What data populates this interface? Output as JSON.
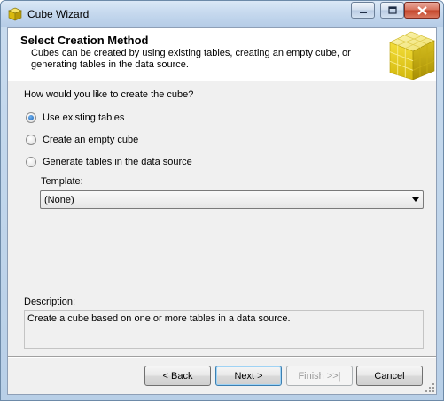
{
  "window": {
    "title": "Cube Wizard"
  },
  "header": {
    "title": "Select Creation Method",
    "description": "Cubes can be created by using existing tables, creating an empty cube, or generating tables in the data source."
  },
  "form": {
    "question": "How would you like to create the cube?",
    "options": [
      {
        "label": "Use existing tables",
        "selected": true
      },
      {
        "label": "Create an empty cube",
        "selected": false
      },
      {
        "label": "Generate tables in the data source",
        "selected": false
      }
    ],
    "template_label": "Template:",
    "template_value": "(None)"
  },
  "description": {
    "label": "Description:",
    "text": "Create a cube based on one or more tables in a data source."
  },
  "buttons": {
    "back": "< Back",
    "next": "Next >",
    "finish": "Finish >>|",
    "cancel": "Cancel"
  },
  "colors": {
    "accent": "#1b5fb3",
    "cube": "#e8d21a"
  }
}
